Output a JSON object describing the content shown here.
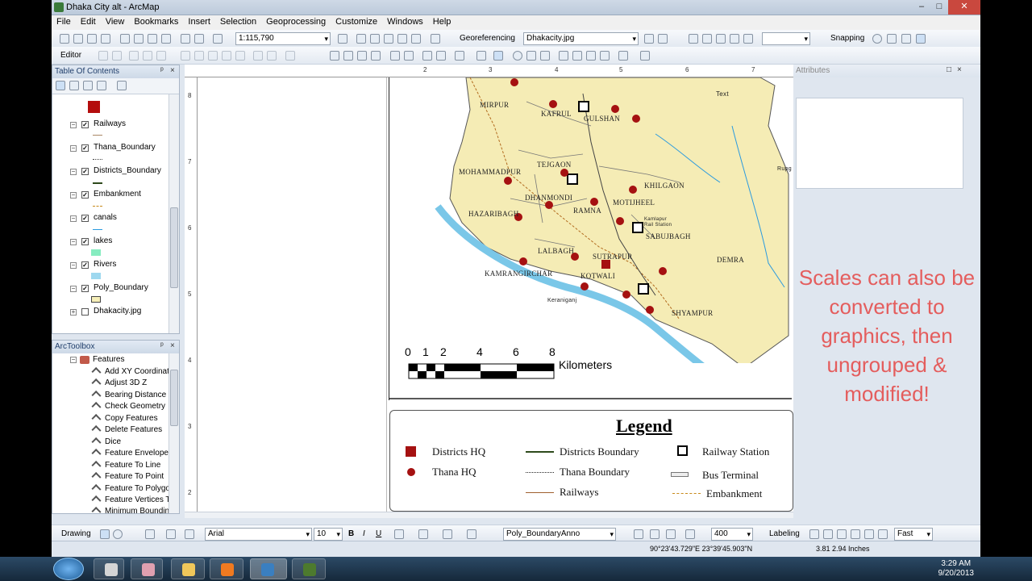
{
  "window": {
    "title": "Dhaka City alt - ArcMap",
    "minimize": "–",
    "maximize": "□",
    "close": "✕"
  },
  "menu": [
    "File",
    "Edit",
    "View",
    "Bookmarks",
    "Insert",
    "Selection",
    "Geoprocessing",
    "Customize",
    "Windows",
    "Help"
  ],
  "toolbar": {
    "scale": "1:115,790",
    "georeferencing_label": "Georeferencing",
    "georef_layer": "Dhakacity.jpg",
    "snapping_label": "Snapping",
    "editor_label": "Editor"
  },
  "toc": {
    "title": "Table Of Contents",
    "layers": [
      {
        "name": "Railways",
        "checked": true
      },
      {
        "name": "Thana_Boundary",
        "checked": true
      },
      {
        "name": "Districts_Boundary",
        "checked": true
      },
      {
        "name": "Embankment",
        "checked": true
      },
      {
        "name": "canals",
        "checked": true
      },
      {
        "name": "lakes",
        "checked": true
      },
      {
        "name": "Rivers",
        "checked": true
      },
      {
        "name": "Poly_Boundary",
        "checked": true
      },
      {
        "name": "Dhakacity.jpg",
        "checked": false
      }
    ]
  },
  "arctoolbox": {
    "title": "ArcToolbox",
    "group": "Features",
    "tools": [
      "Add XY Coordinate",
      "Adjust 3D Z",
      "Bearing Distance T",
      "Check Geometry",
      "Copy Features",
      "Delete Features",
      "Dice",
      "Feature Envelope T",
      "Feature To Line",
      "Feature To Point",
      "Feature To Polygo",
      "Feature Vertices To",
      "Minimum Boundin"
    ]
  },
  "attributes": {
    "title": "Attributes"
  },
  "map": {
    "places": [
      "MIRPUR",
      "KAFRUL",
      "GULSHAN",
      "TEJGAON",
      "MOHAMMADPUR",
      "KHILGAON",
      "DHANMONDI",
      "MOTIJHEEL",
      "HAZARIBAGH",
      "RAMNA",
      "SABUJBAGH",
      "LALBAGH",
      "SUTRAPUR",
      "DEMRA",
      "KAMRANGIRCHAR",
      "KOTWALI",
      "SHYAMPUR"
    ],
    "other_labels": {
      "text": "Text",
      "keraniganj": "Keraniganj",
      "kamlapur": "Kamlapur\nRail Station",
      "rupg": "Rupg"
    },
    "scale_bar": {
      "ticks": [
        "0",
        "1",
        "2",
        "4",
        "6",
        "8"
      ],
      "unit": "Kilometers"
    }
  },
  "legend": {
    "title": "Legend",
    "items": {
      "districts_hq": "Districts HQ",
      "thana_hq": "Thana HQ",
      "districts_boundary": "Districts Boundary",
      "thana_boundary": "Thana Boundary",
      "railways": "Railways",
      "railway_station": "Railway Station",
      "bus_terminal": "Bus Terminal",
      "embankment": "Embankment"
    }
  },
  "note": "Scales can also be converted to graphics, then ungrouped & modified!",
  "drawing": {
    "label": "Drawing",
    "font": "Arial",
    "size": "10",
    "layer": "Poly_BoundaryAnno",
    "zoom": "400",
    "labeling": "Labeling",
    "speed": "Fast"
  },
  "status": {
    "coords": "90°23'43.729\"E  23°39'45.903\"N",
    "page": "3.81  2.94 Inches"
  },
  "taskbar": {
    "time": "3:29 AM",
    "date": "9/20/2013"
  },
  "colors": {
    "land": "#f5ecb5",
    "water": "#7ac7e8",
    "note": "#e45d5d",
    "hq": "#a51111"
  }
}
